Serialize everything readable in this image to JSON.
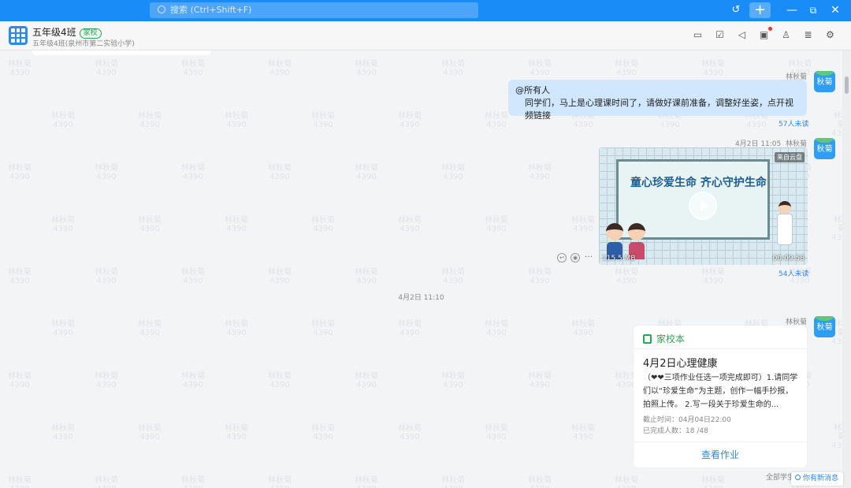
{
  "titlebar": {
    "search_placeholder": "搜索 (Ctrl+Shift+F)",
    "history_icon": "↺",
    "plus_icon": "+",
    "minimize_icon": "—",
    "maximize_icon": "⧉",
    "close_icon": "✕",
    "accent": "#1a8cf7"
  },
  "header": {
    "group_name": "五年级4班",
    "group_badge": "家校",
    "group_subtitle": "五年级4班(泉州市第二实验小学)",
    "icons": [
      "notice-icon",
      "homework-icon",
      "announcement-icon",
      "file-icon",
      "members-icon",
      "search-records-icon",
      "settings-icon"
    ],
    "icon_glyphs": [
      "▭",
      "☑",
      "◁",
      "▣",
      "♙",
      "≣",
      "⚙"
    ]
  },
  "watermark": {
    "line1": "林秋菊",
    "line2": "4390"
  },
  "messages": {
    "msg1": {
      "sender": "林秋菊",
      "avatar_text": "秋菊",
      "mention": "@所有人",
      "text": "同学们，马上是心理课时间了，请做好课前准备，调整好坐姿，点开视频链接",
      "unread": "57人未读"
    },
    "msg2": {
      "time": "4月2日 11:05",
      "sender": "林秋菊",
      "avatar_text": "秋菊",
      "video_title": "童心珍爱生命  齐心守护生命",
      "video_tag": "来自云盘",
      "video_size": "115.5 MB",
      "video_duration": "00:09:58",
      "unread": "54人未读"
    },
    "divider_time": "4月2日 11:10",
    "msg3": {
      "sender": "林秋菊",
      "avatar_text": "秋菊",
      "card_app": "家校本",
      "card_title": "4月2日心理健康",
      "card_body": "（❤❤三项作业任选一项完成即可）1.请同学们以“珍爱生命”为主题，创作一幅手抄报，拍照上传。 2.写一段关于珍爱生命的...",
      "deadline": "截止时间：04月04日22:00",
      "completed": "已完成人数：18 /48",
      "action": "查看作业"
    }
  },
  "footer": {
    "all_read": "全部学生",
    "new_message": "你有新消息"
  }
}
